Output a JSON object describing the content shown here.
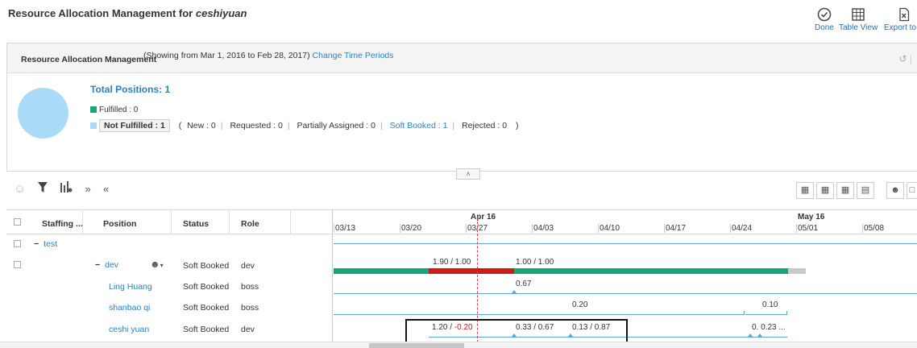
{
  "page": {
    "title_prefix": "Resource Allocation Management for",
    "title_name": "ceshiyuan"
  },
  "toolbar": {
    "done_label": "Done",
    "table_view_label": "Table View",
    "export_label": "Export to E"
  },
  "panel": {
    "title": "Resource Allocation Management",
    "range": "(Showing from Mar 1, 2016 to Feb 28, 2017)",
    "change_link": "Change Time Periods"
  },
  "summary": {
    "total": "Total Positions:  1",
    "fulfilled": "Fulfilled : 0",
    "not_fulfilled": "Not Fulfilled : 1",
    "open_paren": "(",
    "new": "New : 0",
    "requested": "Requested : 0",
    "partially_assigned": "Partially Assigned : 0",
    "soft_booked": "Soft Booked : 1",
    "rejected": "Rejected : 0",
    "close_paren": ")",
    "colors": {
      "fulfilled": "#1aa37a",
      "not_fulfilled": "#a9dbf9",
      "circle": "#a9dbf9"
    }
  },
  "grid": {
    "headers": {
      "staffing": "Staffing ...",
      "position": "Position",
      "status": "Status",
      "role": "Role"
    },
    "rows": [
      {
        "position": "test",
        "status": "",
        "role": ""
      },
      {
        "position": "dev",
        "status": "Soft Booked",
        "role": "dev"
      },
      {
        "position": "Ling Huang",
        "status": "Soft Booked",
        "role": "boss"
      },
      {
        "position": "shanbao qi",
        "status": "Soft Booked",
        "role": "boss"
      },
      {
        "position": "ceshi yuan",
        "status": "Soft Booked",
        "role": "dev"
      }
    ]
  },
  "timeline": {
    "months": [
      "Apr 16",
      "May 16"
    ],
    "weeks": [
      "03/13",
      "03/20",
      "03/27",
      "04/03",
      "04/10",
      "04/17",
      "04/24",
      "05/01",
      "05/08"
    ],
    "dev_values": [
      "1.90 / 1.00",
      "1.00 / 1.00"
    ],
    "ling_values": [
      "0.67"
    ],
    "shanbao_values": [
      "0.20",
      "0.10"
    ],
    "ceshi_values": {
      "a_left": "1.20 / ",
      "a_right": "-0.20",
      "b": "0.33 / 0.67",
      "c": "0.13 / 0.87",
      "d": "0.  0.23 ..."
    },
    "colors": {
      "green": "#1aa37a",
      "red": "#cc1b1b",
      "grey": "#c8c8c8",
      "blue": "#5aa7dd"
    }
  }
}
